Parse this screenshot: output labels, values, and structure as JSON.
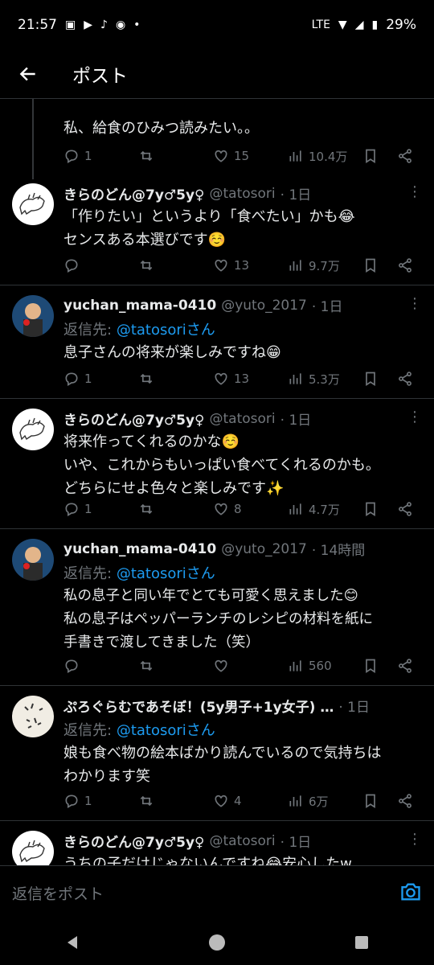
{
  "status": {
    "time": "21:57",
    "battery": "29%",
    "network": "LTE"
  },
  "appbar": {
    "title": "ポスト"
  },
  "tweets": [
    {
      "body": "私、給食のひみつ読みたい。。",
      "reply": "1",
      "retweet": "",
      "like": "15",
      "views": "10.4万"
    },
    {
      "name": "きらのどん@7y♂5y♀",
      "handle": "@tatosori",
      "time": "· 1日",
      "body": "「作りたい」というより「食べたい」かも😂\nセンスある本選びです☺️",
      "reply": "",
      "retweet": "",
      "like": "13",
      "views": "9.7万"
    },
    {
      "name": "yuchan_mama-0410",
      "handle": "@yuto_2017",
      "time": "· 1日",
      "reply_label": "返信先:",
      "reply_target": "@tatosoriさん",
      "body": "息子さんの将来が楽しみですね😁",
      "reply": "1",
      "retweet": "",
      "like": "13",
      "views": "5.3万"
    },
    {
      "name": "きらのどん@7y♂5y♀",
      "handle": "@tatosori",
      "time": "· 1日",
      "body": "将来作ってくれるのかな☺️\nいや、これからもいっぱい食べてくれるのかも。\nどちらにせよ色々と楽しみです✨",
      "reply": "1",
      "retweet": "",
      "like": "8",
      "views": "4.7万"
    },
    {
      "name": "yuchan_mama-0410",
      "handle": "@yuto_2017",
      "time": "· 14時間",
      "reply_label": "返信先:",
      "reply_target": "@tatosoriさん",
      "body": "私の息子と同い年でとても可愛く思えました😊\n私の息子はペッパーランチのレシピの材料を紙に\n手書きで渡してきました（笑）",
      "reply": "",
      "retweet": "",
      "like": "",
      "views": "560"
    },
    {
      "name": "ぷろぐらむであそぼ！(5y男子+1y女子) …",
      "handle": "",
      "time": "· 1日",
      "reply_label": "返信先:",
      "reply_target": "@tatosoriさん",
      "body": "娘も食べ物の絵本ばかり読んでいるので気持ちは\nわかります笑",
      "reply": "1",
      "retweet": "",
      "like": "4",
      "views": "6万"
    },
    {
      "name": "きらのどん@7y♂5y♀",
      "handle": "@tatosori",
      "time": "· 1日",
      "body": "うちの子だけじゃないんですね😂安心したw"
    }
  ],
  "replybar": {
    "placeholder": "返信をポスト"
  },
  "colors": {
    "accent": "#1d9bf0",
    "muted": "#71767b",
    "divider": "#2f3336"
  }
}
